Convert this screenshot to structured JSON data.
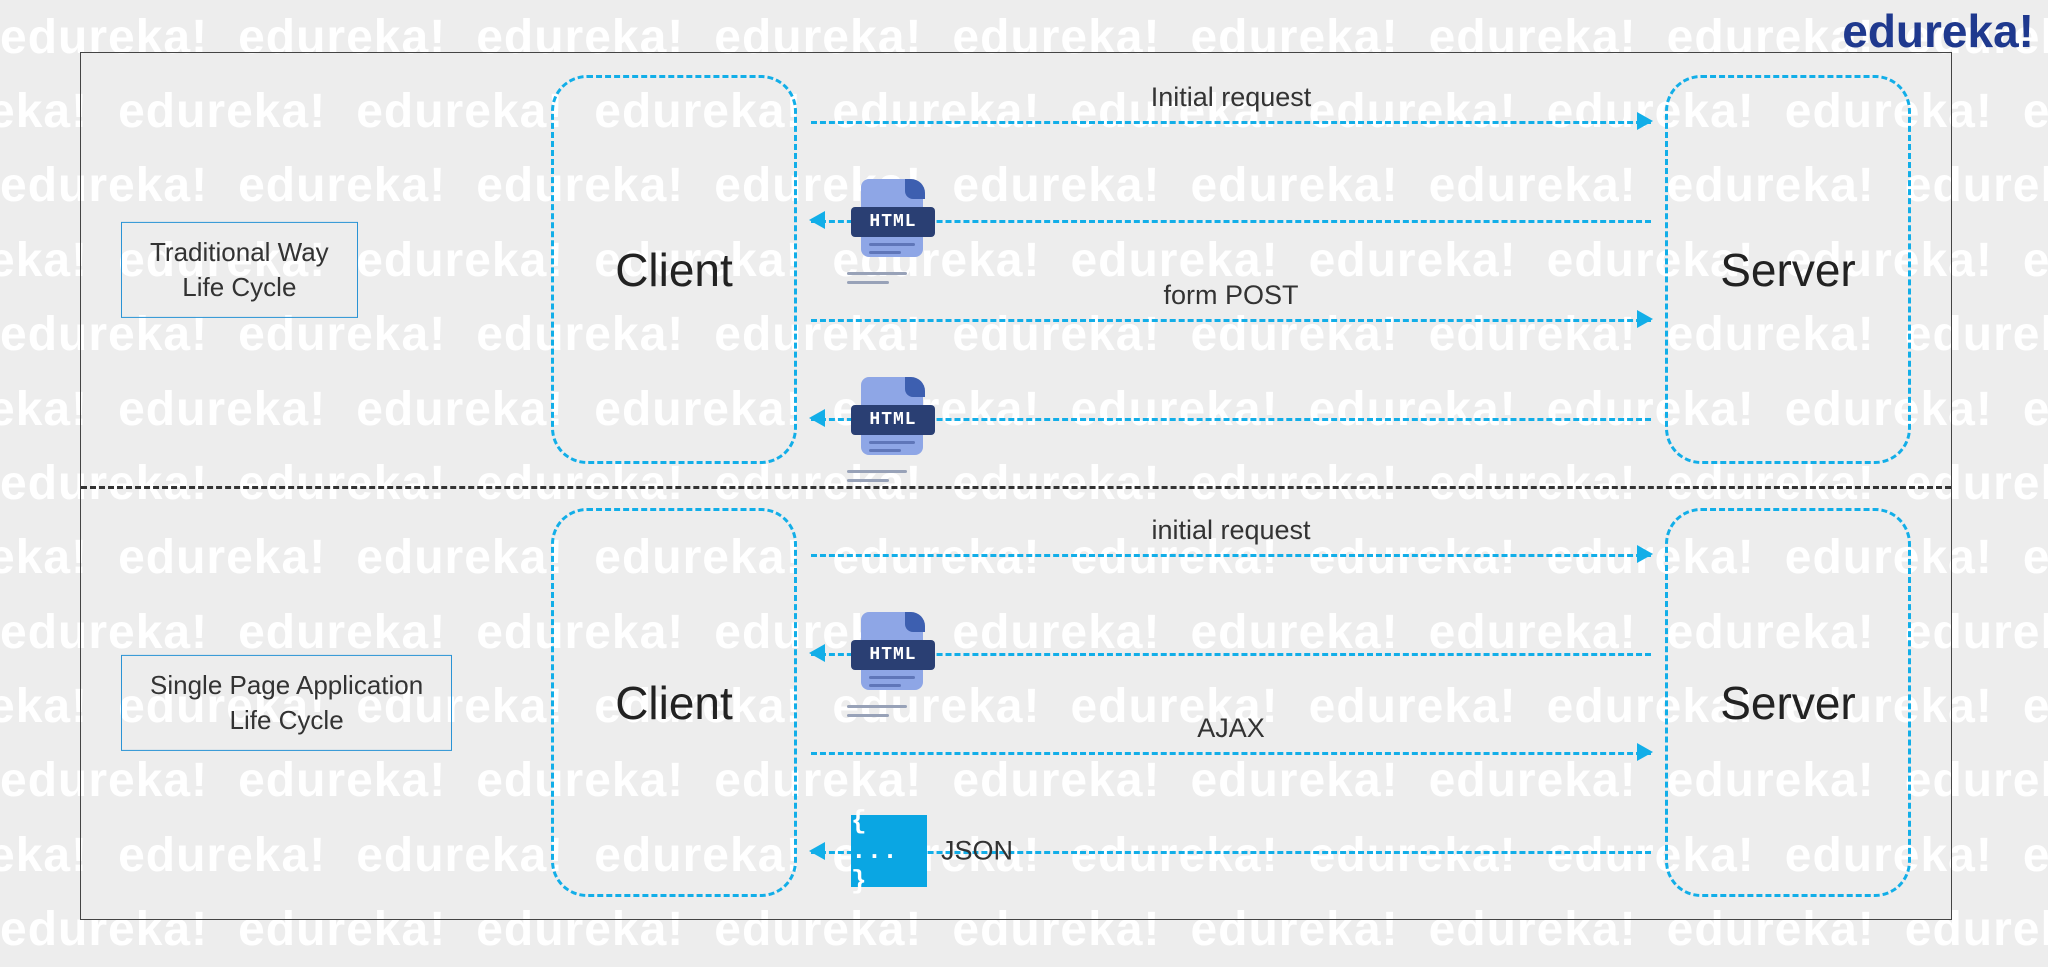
{
  "brand": "edureka!",
  "watermark_word": "edureka!",
  "panels": {
    "traditional": {
      "title_line1": "Traditional Way",
      "title_line2": "Life Cycle",
      "client_label": "Client",
      "server_label": "Server",
      "flows": [
        {
          "dir": "right",
          "label": "Initial request",
          "badge": null
        },
        {
          "dir": "left",
          "label": "",
          "badge": "html"
        },
        {
          "dir": "right",
          "label": "form POST",
          "badge": null
        },
        {
          "dir": "left",
          "label": "",
          "badge": "html"
        }
      ]
    },
    "spa": {
      "title_line1": "Single Page Application",
      "title_line2": "Life Cycle",
      "client_label": "Client",
      "server_label": "Server",
      "flows": [
        {
          "dir": "right",
          "label": "initial request",
          "badge": null
        },
        {
          "dir": "left",
          "label": "",
          "badge": "html"
        },
        {
          "dir": "right",
          "label": "AJAX",
          "badge": null
        },
        {
          "dir": "left",
          "label": "",
          "badge": "json",
          "badge_label": "JSON"
        }
      ]
    }
  },
  "badges": {
    "html_text": "HTML",
    "json_text": "{ ... }",
    "json_label": "JSON"
  },
  "colors": {
    "dash": "#12aee8",
    "brand": "#1f398e",
    "json_bg": "#0aa6e3",
    "html_tag": "#2a3f73"
  }
}
